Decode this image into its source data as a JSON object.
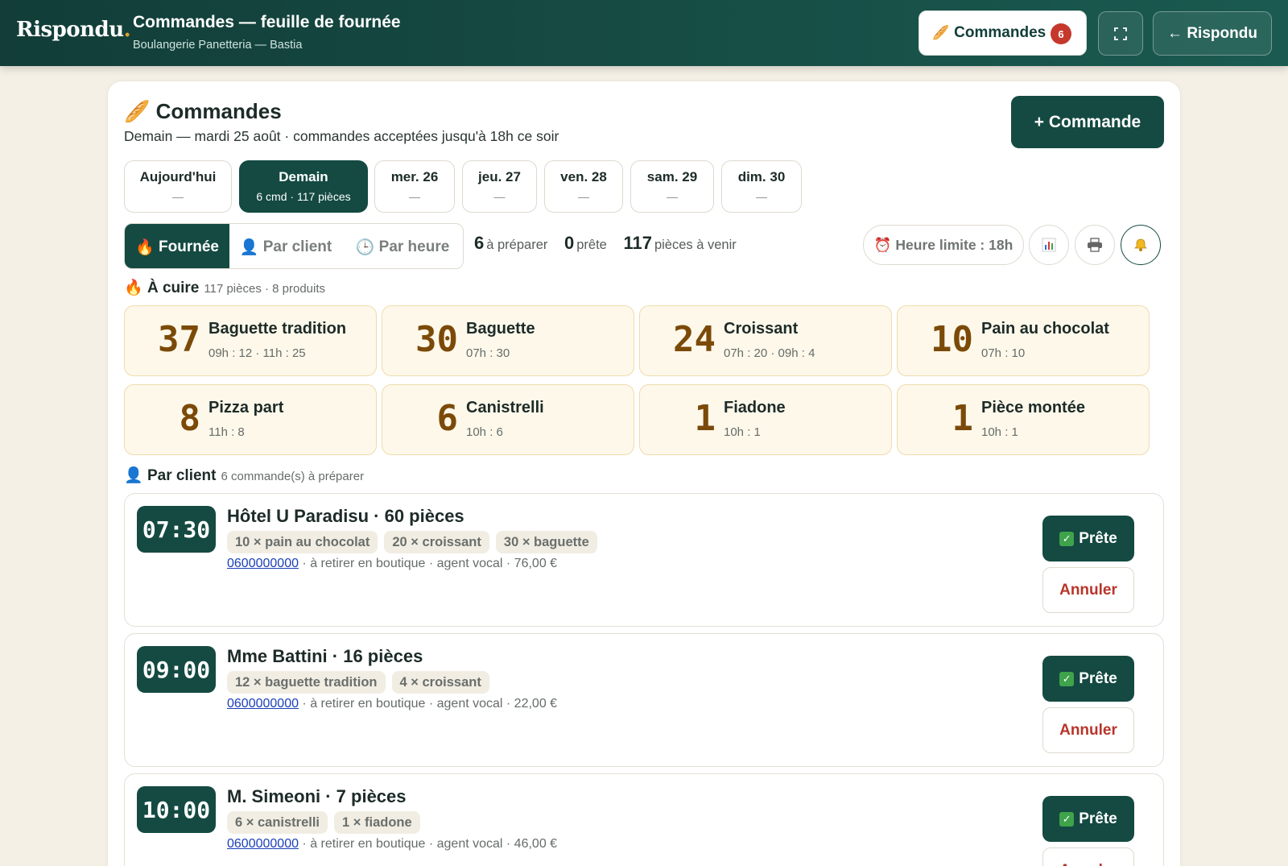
{
  "header": {
    "brand": "Rispondu",
    "brand_dot": ".",
    "title": "Commandes — feuille de fournée",
    "subtitle": "Boulangerie Panetteria — Bastia",
    "orders_label": "Commandes",
    "orders_count": "6",
    "back_label": "← Rispondu"
  },
  "main": {
    "title": "Commandes",
    "subtitle": "Demain — mardi 25 août · commandes acceptées jusqu'à 18h ce soir",
    "new_button": "+ Commande",
    "days": [
      {
        "label": "Aujourd'hui",
        "sub": "—"
      },
      {
        "label": "Demain",
        "sub": "6 cmd · 117 pièces"
      },
      {
        "label": "mer. 26",
        "sub": "—"
      },
      {
        "label": "jeu. 27",
        "sub": "—"
      },
      {
        "label": "ven. 28",
        "sub": "—"
      },
      {
        "label": "sam. 29",
        "sub": "—"
      },
      {
        "label": "dim. 30",
        "sub": "—"
      }
    ],
    "views": [
      {
        "icon": "🔥",
        "label": "Fournée"
      },
      {
        "icon": "👤",
        "label": "Par client"
      },
      {
        "icon": "🕒",
        "label": "Par heure"
      }
    ],
    "stats": {
      "to_prepare_value": "6",
      "to_prepare_label": "à préparer",
      "ready_value": "0",
      "ready_label": "prête",
      "pieces_value": "117",
      "pieces_label": "pièces à venir"
    },
    "deadline": "⏰ Heure limite : 18h",
    "bake_section": {
      "title": "À cuire",
      "note": "117 pièces · 8 produits"
    },
    "products": [
      {
        "qty": "37",
        "name": "Baguette tradition",
        "times": "09h : 12 · 11h : 25"
      },
      {
        "qty": "30",
        "name": "Baguette",
        "times": "07h : 30"
      },
      {
        "qty": "24",
        "name": "Croissant",
        "times": "07h : 20 · 09h : 4"
      },
      {
        "qty": "10",
        "name": "Pain au chocolat",
        "times": "07h : 10"
      },
      {
        "qty": "8",
        "name": "Pizza part",
        "times": "11h : 8"
      },
      {
        "qty": "6",
        "name": "Canistrelli",
        "times": "10h : 6"
      },
      {
        "qty": "1",
        "name": "Fiadone",
        "times": "10h : 1"
      },
      {
        "qty": "1",
        "name": "Pièce montée",
        "times": "10h : 1"
      }
    ],
    "client_section": {
      "title": "Par client",
      "note": "6 commande(s) à préparer"
    },
    "orders": [
      {
        "time": "07:30",
        "name": "Hôtel U Paradisu · 60 pièces",
        "items": [
          "10 × pain au chocolat",
          "20 × croissant",
          "30 × baguette"
        ],
        "phone": "0600000000",
        "details": " · à retirer en boutique · agent vocal · 76,00 €",
        "ready_label": "Prête",
        "cancel_label": "Annuler"
      },
      {
        "time": "09:00",
        "name": "Mme Battini · 16 pièces",
        "items": [
          "12 × baguette tradition",
          "4 × croissant"
        ],
        "phone": "0600000000",
        "details": " · à retirer en boutique · agent vocal · 22,00 €",
        "ready_label": "Prête",
        "cancel_label": "Annuler"
      },
      {
        "time": "10:00",
        "name": "M. Simeoni · 7 pièces",
        "items": [
          "6 × canistrelli",
          "1 × fiadone"
        ],
        "phone": "0600000000",
        "details": " · à retirer en boutique · agent vocal · 46,00 €",
        "ready_label": "Prête",
        "cancel_label": "Annuler"
      }
    ]
  },
  "icons": {
    "bread": "bread-icon",
    "fullscreen": "fullscreen-icon",
    "chart": "bar-chart-icon",
    "print": "printer-icon",
    "bell": "bell-icon",
    "fire": "fire-icon",
    "person": "person-icon",
    "clock": "clock-icon",
    "alarm": "alarm-clock-icon",
    "check": "check-icon"
  },
  "colors": {
    "primary": "#144a42",
    "accent": "#e5a02b",
    "badge": "#c6382c",
    "cancel": "#b8352a",
    "product_bg": "#fdf8ea"
  }
}
